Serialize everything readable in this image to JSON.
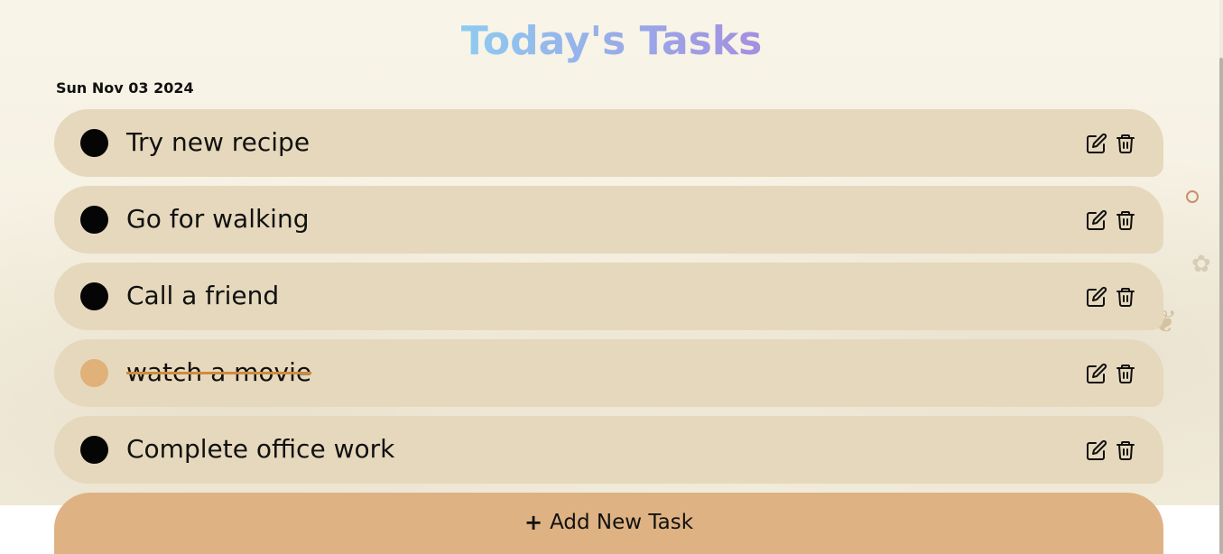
{
  "header": {
    "title": "Today's Tasks",
    "date": "Sun Nov 03 2024"
  },
  "tasks": [
    {
      "label": "Try new recipe",
      "completed": false
    },
    {
      "label": "Go for walking",
      "completed": false
    },
    {
      "label": "Call a friend",
      "completed": false
    },
    {
      "label": "watch a movie",
      "completed": true
    },
    {
      "label": "Complete office work",
      "completed": false
    }
  ],
  "icons": {
    "status": "status-dot-icon",
    "edit": "edit-icon",
    "delete": "trash-icon",
    "add": "plus-icon"
  },
  "add_button": {
    "icon_glyph": "+",
    "label": "Add New Task"
  },
  "colors": {
    "title_gradient_start": "#8ecbf0",
    "title_gradient_end": "#a48fe0",
    "task_background": "#e6d8bc",
    "dot_pending": "#050505",
    "dot_done": "#e0b178",
    "strikethrough": "#d08a3c",
    "add_button": "#deb283"
  }
}
